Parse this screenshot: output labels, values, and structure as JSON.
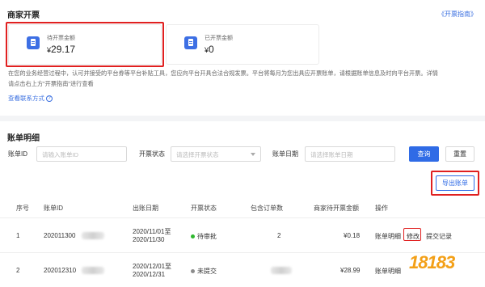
{
  "section1": {
    "title": "商家开票",
    "guide_link": "《开票指南》",
    "card_pending": {
      "label": "待开票金额",
      "currency": "¥",
      "value": "29.17",
      "icon": "invoice-icon"
    },
    "card_done": {
      "label": "已开票金额",
      "currency": "¥",
      "value": "0",
      "icon": "invoice-icon"
    },
    "desc_line1": "在您的业务经营过程中，认可并接受的平台券等平台补贴工具，您应向平台开具合法合规发票。平台将每月为您出具应开票账单，请根据账单信息及时向平台开票。详情",
    "desc_line2": "请点击右上方\"开票指南\"进行查看",
    "contact_link": "查看联系方式",
    "help_icon": "?"
  },
  "section2": {
    "title": "账单明细",
    "filters": {
      "bill_id_label": "账单ID",
      "bill_id_placeholder": "请输入账单ID",
      "status_label": "开票状态",
      "status_placeholder": "请选择开票状态",
      "date_label": "账单日期",
      "date_placeholder": "请选择账单日期",
      "search_button": "查询",
      "reset_button": "重置"
    },
    "export_button": "导出账单",
    "table": {
      "headers": [
        "序号",
        "账单ID",
        "出账日期",
        "开票状态",
        "包含订单数",
        "商家待开票金额",
        "操作"
      ],
      "rows": [
        {
          "index": "1",
          "bill_id": "202011300",
          "date_line1": "2020/11/01至",
          "date_line2": "2020/11/30",
          "status": "待审批",
          "status_color": "#2eb82e",
          "order_count": "2",
          "amount": "¥0.18",
          "actions": [
            "账单明细",
            "修改",
            "提交记录"
          ]
        },
        {
          "index": "2",
          "bill_id": "202012310",
          "date_line1": "2020/12/01至",
          "date_line2": "2020/12/31",
          "status": "未提交",
          "status_color": "#8c8c8c",
          "order_count": "",
          "amount": "¥28.99",
          "actions": [
            "账单明细"
          ]
        }
      ]
    }
  },
  "watermark": "18183"
}
